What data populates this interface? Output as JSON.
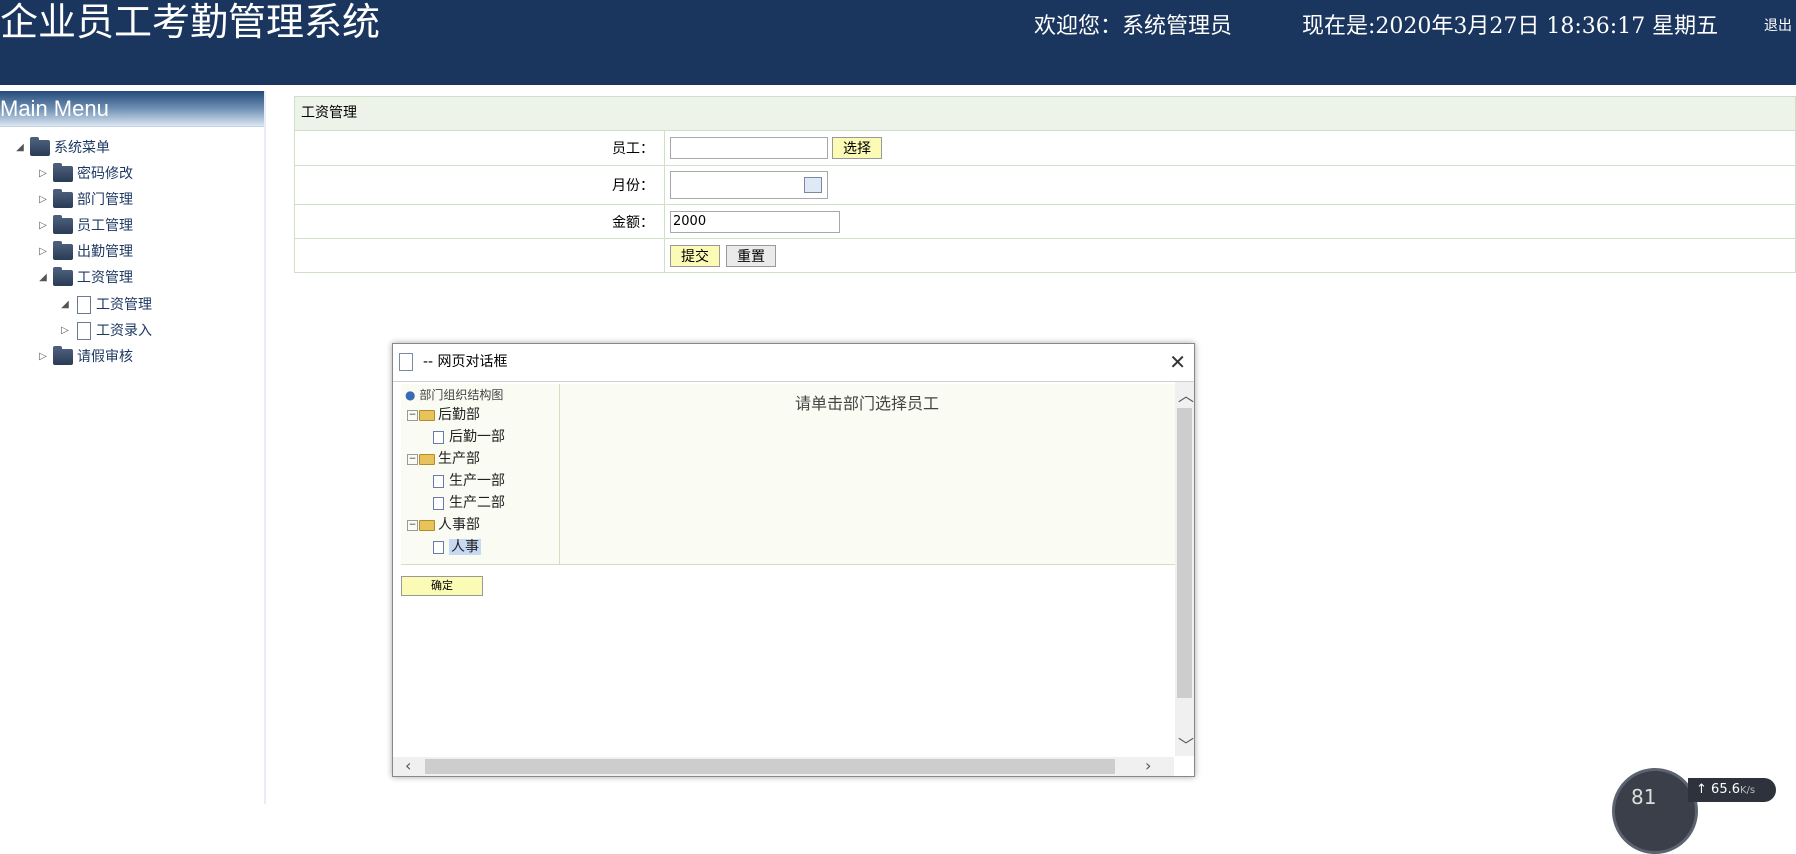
{
  "header": {
    "title": "企业员工考勤管理系统",
    "welcome": "欢迎您：系统管理员",
    "datetime": "现在是:2020年3月27日 18:36:17 星期五",
    "logout": "退出",
    "bg_color": "#1b365e"
  },
  "sidebar": {
    "heading": "Main Menu",
    "root": "系统菜单",
    "items": [
      {
        "label": "密码修改"
      },
      {
        "label": "部门管理"
      },
      {
        "label": "员工管理"
      },
      {
        "label": "出勤管理"
      },
      {
        "label": "工资管理",
        "expanded": true,
        "children": [
          {
            "label": "工资管理"
          },
          {
            "label": "工资录入"
          }
        ]
      },
      {
        "label": "请假审核"
      }
    ]
  },
  "form": {
    "title": "工资管理",
    "employee_label": "员工：",
    "employee_value": "",
    "select_button": "选择",
    "month_label": "月份：",
    "month_value": "",
    "amount_label": "金额：",
    "amount_value": "2000",
    "submit_button": "提交",
    "reset_button": "重置"
  },
  "dialog": {
    "title": "-- 网页对话框",
    "hint": "请单击部门选择员工",
    "ok_button": "确定",
    "tree": {
      "root": "部门组织结构图",
      "departments": [
        {
          "name": "后勤部",
          "children": [
            "后勤一部"
          ]
        },
        {
          "name": "生产部",
          "children": [
            "生产一部",
            "生产二部"
          ]
        },
        {
          "name": "人事部",
          "children": [
            "人事"
          ]
        }
      ],
      "selected": "人事"
    }
  },
  "net_widget": {
    "gauge": "81",
    "speed": "65.6",
    "unit": "K/s"
  }
}
